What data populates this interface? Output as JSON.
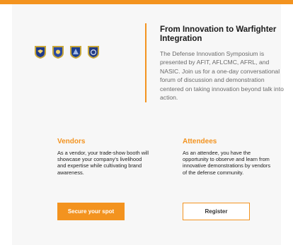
{
  "header": {
    "accent_color": "#f3931f"
  },
  "emblems": [
    "shield-icon-afit",
    "shield-icon-aflcmc",
    "shield-icon-afrl",
    "shield-icon-nasic"
  ],
  "intro": {
    "title": "From Innovation to Warfighter Integration",
    "body": "The Defense Innovation Symposium is presented by AFIT, AFLCMC, AFRL, and NASIC. Join us for a one-day conversational forum of discussion and demonstration centered on taking innovation beyond talk into action."
  },
  "vendors": {
    "title": "Vendors",
    "body": "As a vendor, your trade-show booth will showcase your company's livelihood and expertise while cultivating brand awareness.",
    "button": "Secure your spot"
  },
  "attendees": {
    "title": "Attendees",
    "body": "As an attendee, you have the opportunity to observe and learn from innovative demonstrations by vendors of the defense community.",
    "button": "Register"
  }
}
